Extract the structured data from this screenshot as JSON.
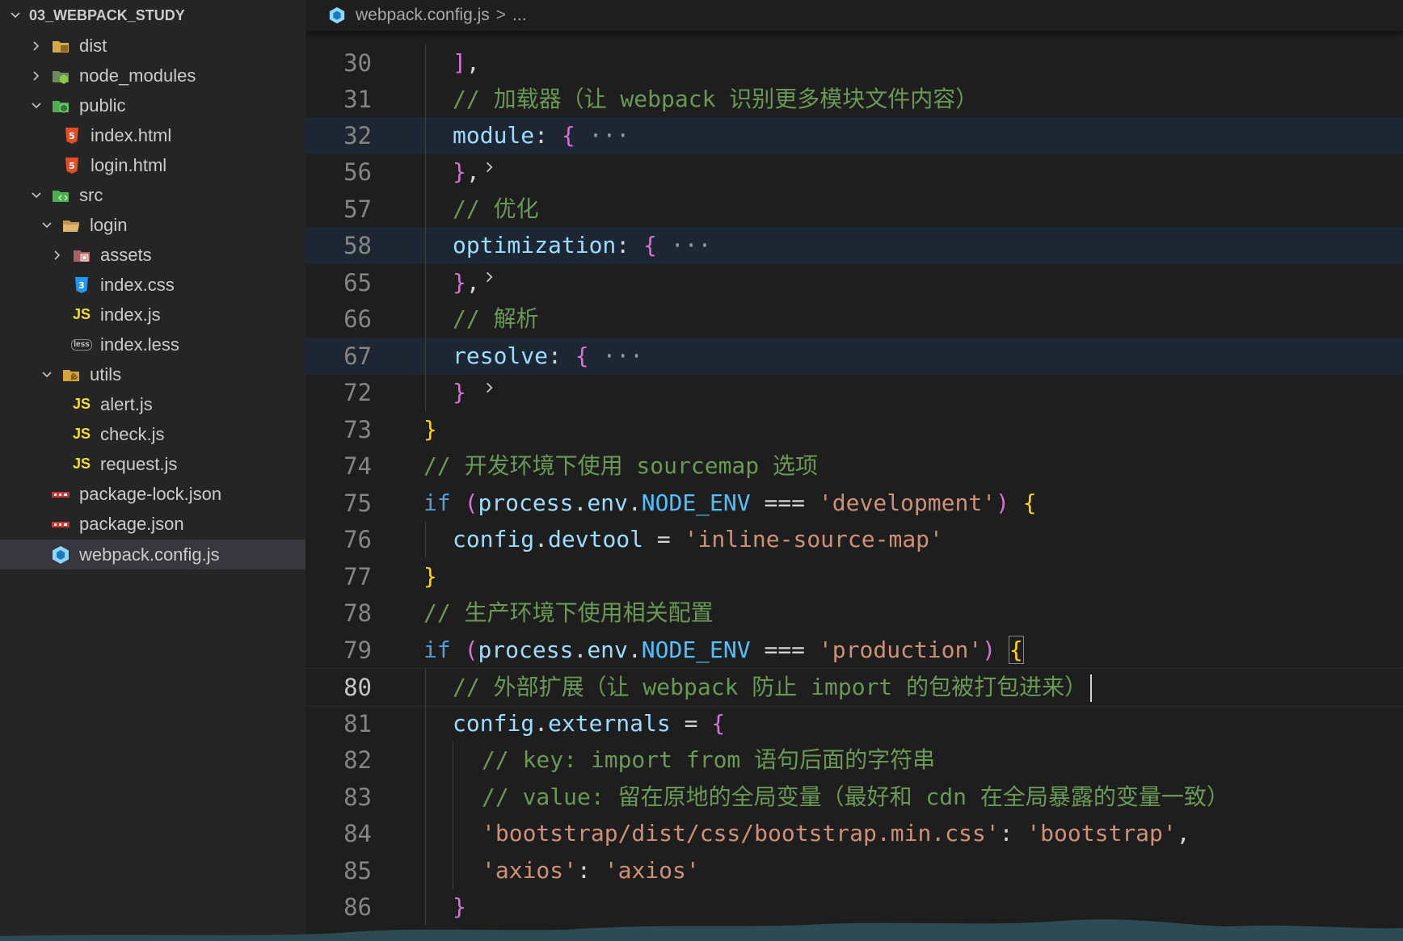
{
  "explorer": {
    "root": "03_WEBPACK_STUDY",
    "items": [
      {
        "label": "dist",
        "type": "folder",
        "icon": "dist-folder-icon",
        "expanded": false
      },
      {
        "label": "node_modules",
        "type": "folder",
        "icon": "node-modules-folder-icon",
        "expanded": false
      },
      {
        "label": "public",
        "type": "folder",
        "icon": "public-folder-icon",
        "expanded": true
      },
      {
        "label": "index.html",
        "type": "file",
        "icon": "html-file-icon"
      },
      {
        "label": "login.html",
        "type": "file",
        "icon": "html-file-icon"
      },
      {
        "label": "src",
        "type": "folder",
        "icon": "src-folder-icon",
        "expanded": true
      },
      {
        "label": "login",
        "type": "folder",
        "icon": "folder-open-icon",
        "expanded": true
      },
      {
        "label": "assets",
        "type": "folder",
        "icon": "assets-folder-icon",
        "expanded": false
      },
      {
        "label": "index.css",
        "type": "file",
        "icon": "css-file-icon"
      },
      {
        "label": "index.js",
        "type": "file",
        "icon": "js-file-icon",
        "badge": "JS"
      },
      {
        "label": "index.less",
        "type": "file",
        "icon": "less-file-icon",
        "badge": "less"
      },
      {
        "label": "utils",
        "type": "folder",
        "icon": "utils-folder-icon",
        "expanded": true
      },
      {
        "label": "alert.js",
        "type": "file",
        "icon": "js-file-icon",
        "badge": "JS"
      },
      {
        "label": "check.js",
        "type": "file",
        "icon": "js-file-icon",
        "badge": "JS"
      },
      {
        "label": "request.js",
        "type": "file",
        "icon": "js-file-icon",
        "badge": "JS"
      },
      {
        "label": "package-lock.json",
        "type": "file",
        "icon": "npm-file-icon"
      },
      {
        "label": "package.json",
        "type": "file",
        "icon": "npm-file-icon"
      },
      {
        "label": "webpack.config.js",
        "type": "file",
        "icon": "webpack-file-icon",
        "selected": true
      }
    ]
  },
  "breadcrumb": {
    "file": "webpack.config.js",
    "separator": ">",
    "more": "..."
  },
  "editor": {
    "active_line": "80",
    "lines": [
      {
        "n": "30",
        "code": "],"
      },
      {
        "n": "31",
        "code": "// 加载器（让 webpack 识别更多模块文件内容）"
      },
      {
        "n": "32",
        "code": "module: {",
        "folded": "···"
      },
      {
        "n": "56",
        "code": "},"
      },
      {
        "n": "57",
        "code": "// 优化"
      },
      {
        "n": "58",
        "code": "optimization: {",
        "folded": "···"
      },
      {
        "n": "65",
        "code": "},"
      },
      {
        "n": "66",
        "code": "// 解析"
      },
      {
        "n": "67",
        "code": "resolve: {",
        "folded": "···"
      },
      {
        "n": "72",
        "code": "}"
      },
      {
        "n": "73",
        "code": "}"
      },
      {
        "n": "74",
        "code": "// 开发环境下使用 sourcemap 选项"
      },
      {
        "n": "75",
        "code": "if (process.env.NODE_ENV === 'development') {"
      },
      {
        "n": "76",
        "code": "config.devtool = 'inline-source-map'"
      },
      {
        "n": "77",
        "code": "}"
      },
      {
        "n": "78",
        "code": "// 生产环境下使用相关配置"
      },
      {
        "n": "79",
        "code": "if (process.env.NODE_ENV === 'production') {"
      },
      {
        "n": "80",
        "code": "// 外部扩展（让 webpack 防止 import 的包被打包进来）"
      },
      {
        "n": "81",
        "code": "config.externals = {"
      },
      {
        "n": "82",
        "code": "// key: import from 语句后面的字符串"
      },
      {
        "n": "83",
        "code": "// value: 留在原地的全局变量（最好和 cdn 在全局暴露的变量一致）"
      },
      {
        "n": "84",
        "code": "'bootstrap/dist/css/bootstrap.min.css': 'bootstrap',"
      },
      {
        "n": "85",
        "code": "'axios': 'axios'"
      },
      {
        "n": "86",
        "code": "}"
      }
    ]
  },
  "colors": {
    "sidebar_bg": "#252526",
    "editor_bg": "#1e1e1e",
    "selected_row": "#37373d",
    "comment": "#6a9955",
    "string": "#ce9178",
    "keyword": "#569cd6",
    "property": "#9cdcfe",
    "constant": "#4fc1ff",
    "brace_level1": "#ffd700",
    "brace_level2": "#da70d6"
  }
}
